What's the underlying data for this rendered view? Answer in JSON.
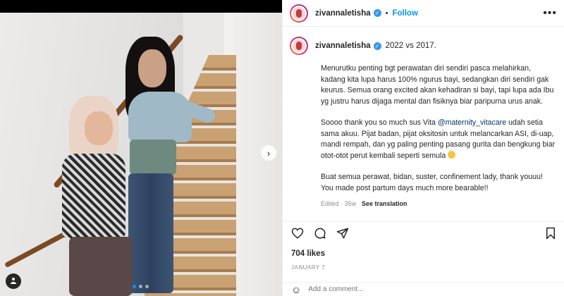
{
  "post": {
    "carousel_position": 1,
    "carousel_total": 3
  },
  "header": {
    "username": "zivannaletisha",
    "separator": "•",
    "follow_label": "Follow",
    "more_icon": "more-horizontal-icon"
  },
  "caption": {
    "username": "zivannaletisha",
    "title": "2022 vs 2017.",
    "paragraph1": "Menurutku penting bgt perawatan diri sendiri pasca melahirkan, kadang kita lupa harus 100% ngurus bayi, sedangkan diri sendiri gak keurus. Semua orang excited akan kehadiran si bayi, tapi lupa ada Ibu yg justru harus dijaga mental dan fisiknya biar paripurna urus anak.",
    "paragraph2_before": "Soooo thank you so much sus Vita ",
    "paragraph2_mention": "@maternity_vitacare",
    "paragraph2_after": " udah setia sama akuu. Pijat badan, pijat oksitosin untuk melancarkan ASI, di-uap, mandi rempah, dan yg paling penting pasang gurita dan bengkung biar otot-otot perut kembali seperti semula",
    "paragraph3": "Buat semua perawat, bidan, suster, confinement lady, thank youuu! You made post partum days much more bearable!!",
    "edited": "Edited · 35w",
    "see_translation": "See translation"
  },
  "actions": {
    "like_icon": "heart-icon",
    "comment_icon": "comment-icon",
    "share_icon": "share-icon",
    "save_icon": "bookmark-icon"
  },
  "likes": "704 likes",
  "date": "JANUARY 7",
  "comment": {
    "placeholder": "Add a comment..."
  },
  "colors": {
    "accent": "#0095f6",
    "verified": "#3897f0",
    "text": "#262626",
    "muted": "#8e8e8e"
  }
}
